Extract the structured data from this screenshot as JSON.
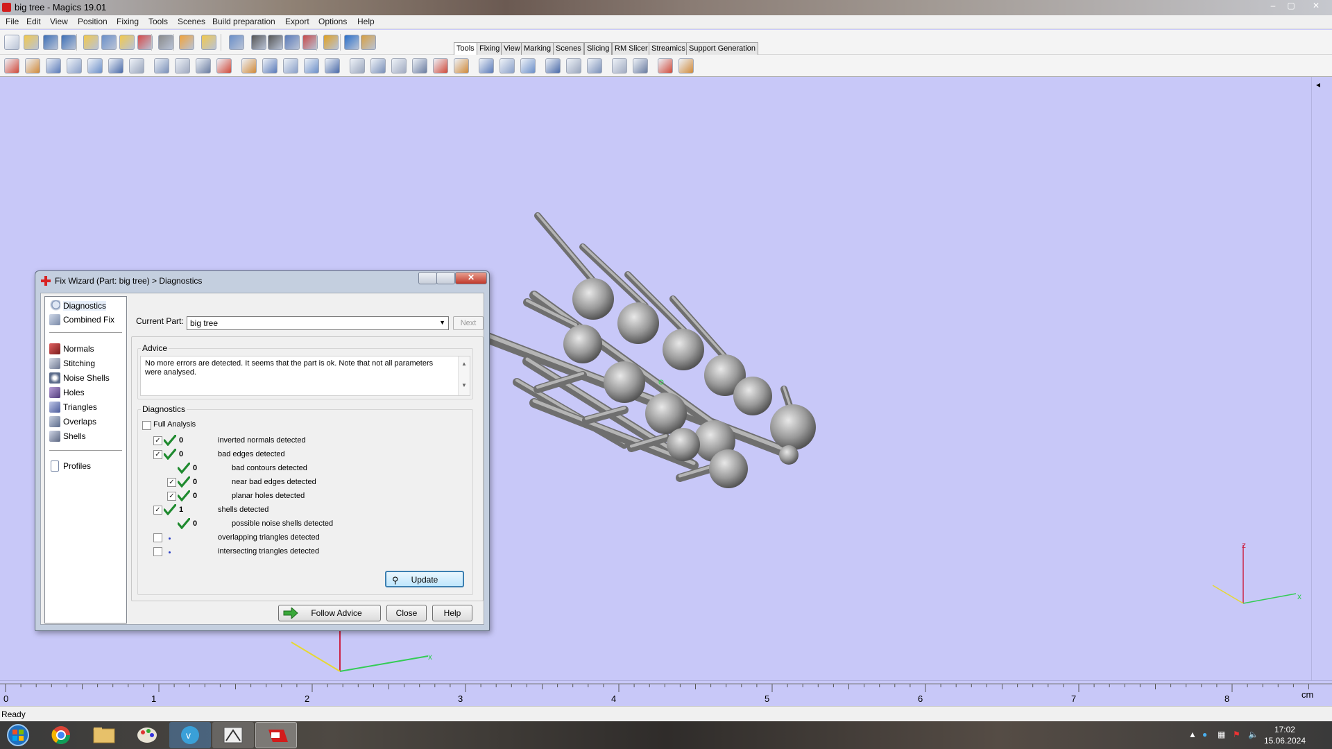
{
  "window": {
    "title": "big tree - Magics 19.01",
    "minimize": "–",
    "maximize": "▢",
    "close": "✕"
  },
  "menu": [
    "File",
    "Edit",
    "View",
    "Position",
    "Fixing",
    "Tools",
    "Scenes",
    "Build preparation",
    "Export",
    "Options",
    "Help"
  ],
  "toolbar_tabs": [
    {
      "label": "Tools",
      "active": true
    },
    {
      "label": "Fixing",
      "active": false
    },
    {
      "label": "View",
      "active": false
    },
    {
      "label": "Marking",
      "active": false
    },
    {
      "label": "Scenes",
      "active": false
    },
    {
      "label": "Slicing",
      "active": false
    },
    {
      "label": "RM Slicer",
      "active": false
    },
    {
      "label": "Streamics",
      "active": false
    },
    {
      "label": "Support Generation",
      "active": false
    }
  ],
  "toolbar1_icons": [
    "new-file-icon",
    "open-file-icon",
    "save-icon",
    "save-as-icon",
    "import-icon",
    "save-part-icon",
    "load-icon",
    "unload-icon",
    "print-icon",
    "undo-icon",
    "redo-icon",
    "select-part-icon",
    "rotate-view-icon",
    "pan-icon",
    "zoom-icon",
    "zoom-fit-icon",
    "checklist-icon",
    "help-icon",
    "wizard-icon"
  ],
  "toolbar2_icons": [
    "translate-icon",
    "move-icon",
    "rotate-icon",
    "rotate-free-icon",
    "mirror-icon",
    "duplicate-icon",
    "merge-icon",
    "cut-icon",
    "punch-icon",
    "hollow-icon",
    "extrude-icon",
    "offset-icon",
    "label-icon",
    "boolean-icon",
    "smooth-icon",
    "triangle-reduce-icon",
    "fix-icon",
    "box-icon",
    "shell-icon",
    "section-icon",
    "measure-icon",
    "sketch-icon",
    "view-frame-icon",
    "view-box-icon",
    "align-icon",
    "nest-icon",
    "support-icon",
    "platform-icon",
    "render-icon",
    "settings-icon",
    "hatch-icon",
    "package-icon"
  ],
  "dialog": {
    "title": "Fix Wizard (Part: big tree) > Diagnostics",
    "nav": {
      "top": [
        {
          "label": "Diagnostics",
          "icon": "diagnostics-icon",
          "active": true
        },
        {
          "label": "Combined Fix",
          "icon": "combined-fix-icon",
          "active": false
        }
      ],
      "middle": [
        {
          "label": "Normals",
          "icon": "normals-icon"
        },
        {
          "label": "Stitching",
          "icon": "stitching-icon"
        },
        {
          "label": "Noise Shells",
          "icon": "noise-shells-icon"
        },
        {
          "label": "Holes",
          "icon": "holes-icon"
        },
        {
          "label": "Triangles",
          "icon": "triangles-icon"
        },
        {
          "label": "Overlaps",
          "icon": "overlaps-icon"
        },
        {
          "label": "Shells",
          "icon": "shells-icon"
        }
      ],
      "bottom": [
        {
          "label": "Profiles",
          "icon": "profiles-icon"
        }
      ]
    },
    "current_part_label": "Current Part:",
    "current_part_value": "big tree",
    "next_label": "Next",
    "advice_label": "Advice",
    "advice_text": "No more errors are detected. It seems that the part is ok. Note that not all parameters were analysed.",
    "diagnostics_label": "Diagnostics",
    "full_analysis_label": "Full Analysis",
    "full_analysis_checked": false,
    "rows": [
      {
        "checkbox": true,
        "checked": true,
        "indent": false,
        "status": "ok",
        "count": "0",
        "text": "inverted normals detected"
      },
      {
        "checkbox": true,
        "checked": true,
        "indent": false,
        "status": "ok",
        "count": "0",
        "text": "bad edges detected"
      },
      {
        "checkbox": false,
        "checked": false,
        "indent": true,
        "status": "ok",
        "count": "0",
        "text": "bad contours detected"
      },
      {
        "checkbox": true,
        "checked": true,
        "indent": true,
        "status": "ok",
        "count": "0",
        "text": "near bad edges detected"
      },
      {
        "checkbox": true,
        "checked": true,
        "indent": true,
        "status": "ok",
        "count": "0",
        "text": "planar holes detected"
      },
      {
        "checkbox": true,
        "checked": true,
        "indent": false,
        "status": "ok",
        "count": "1",
        "text": "shells detected"
      },
      {
        "checkbox": false,
        "checked": false,
        "indent": true,
        "status": "ok",
        "count": "0",
        "text": "possible noise shells detected"
      },
      {
        "checkbox": true,
        "checked": false,
        "indent": false,
        "status": "pending",
        "count": "",
        "text": "overlapping triangles detected"
      },
      {
        "checkbox": true,
        "checked": false,
        "indent": false,
        "status": "pending",
        "count": "",
        "text": "intersecting triangles detected"
      }
    ],
    "update_label": "Update",
    "follow_advice_label": "Follow Advice",
    "close_label": "Close",
    "help_label": "Help"
  },
  "viewport": {
    "background": "#c8c8f8",
    "axis_labels": {
      "x": "x",
      "z": "z"
    },
    "part_color": "#9a9a9a"
  },
  "ruler": {
    "labels": [
      "0",
      "1",
      "2",
      "3",
      "4",
      "5",
      "6",
      "7",
      "8"
    ],
    "unit": "cm"
  },
  "status": "Ready",
  "taskbar": {
    "apps": [
      "start-button-icon",
      "chrome-icon",
      "file-explorer-icon",
      "paint-icon",
      "vpn-icon",
      "magics-dark-icon",
      "magics-icon"
    ],
    "time": "17:02",
    "date": "15.06.2024"
  }
}
